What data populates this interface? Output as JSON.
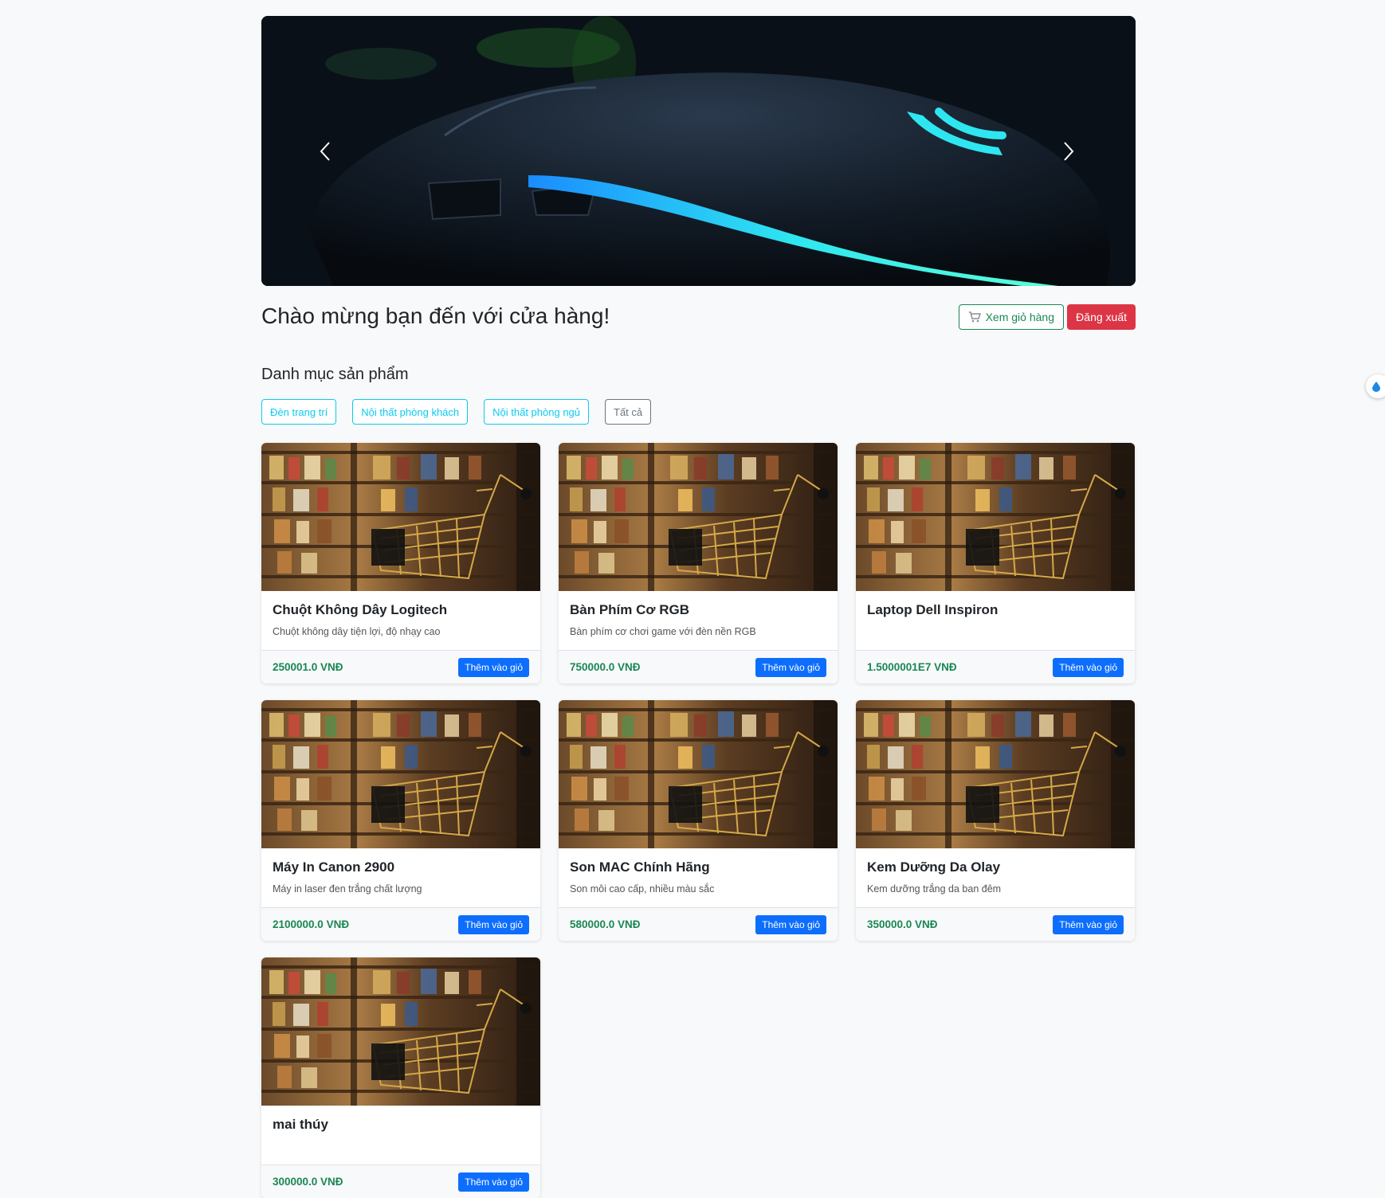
{
  "welcome_title": "Chào mừng bạn đến với cửa hàng!",
  "header_buttons": {
    "cart_label": "Xem giỏ hàng",
    "cart_icon": "cart-icon",
    "logout_label": "Đăng xuất"
  },
  "categories": {
    "title": "Danh mục sản phẩm",
    "items": [
      "Đèn trang trí",
      "Nội thất phòng khách",
      "Nội thất phòng ngủ",
      "Tất cả"
    ]
  },
  "carousel": {
    "prev_icon": "chevron-left-icon",
    "next_icon": "chevron-right-icon"
  },
  "products": [
    {
      "name": "Chuột Không Dây Logitech",
      "description": "Chuột không dây tiện lợi, độ nhạy cao",
      "price": "250001.0 VNĐ",
      "add_label": "Thêm vào giỏ"
    },
    {
      "name": "Bàn Phím Cơ RGB",
      "description": "Bàn phím cơ chơi game với đèn nền RGB",
      "price": "750000.0 VNĐ",
      "add_label": "Thêm vào giỏ"
    },
    {
      "name": "Laptop Dell Inspiron",
      "description": "",
      "price": "1.5000001E7 VNĐ",
      "add_label": "Thêm vào giỏ"
    },
    {
      "name": "Máy In Canon 2900",
      "description": "Máy in laser đen trắng chất lượng",
      "price": "2100000.0 VNĐ",
      "add_label": "Thêm vào giỏ"
    },
    {
      "name": "Son MAC Chính Hãng",
      "description": "Son môi cao cấp, nhiều màu sắc",
      "price": "580000.0 VNĐ",
      "add_label": "Thêm vào giỏ"
    },
    {
      "name": "Kem Dưỡng Da Olay",
      "description": "Kem dưỡng trắng da ban đêm",
      "price": "350000.0 VNĐ",
      "add_label": "Thêm vào giỏ"
    },
    {
      "name": "mai thúy",
      "description": "",
      "price": "300000.0 VNĐ",
      "add_label": "Thêm vào giỏ"
    }
  ],
  "colors": {
    "success": "#198754",
    "danger": "#dc3545",
    "info": "#0dcaf0",
    "primary": "#0d6efd",
    "accent_glow": "#2ee6f0"
  }
}
